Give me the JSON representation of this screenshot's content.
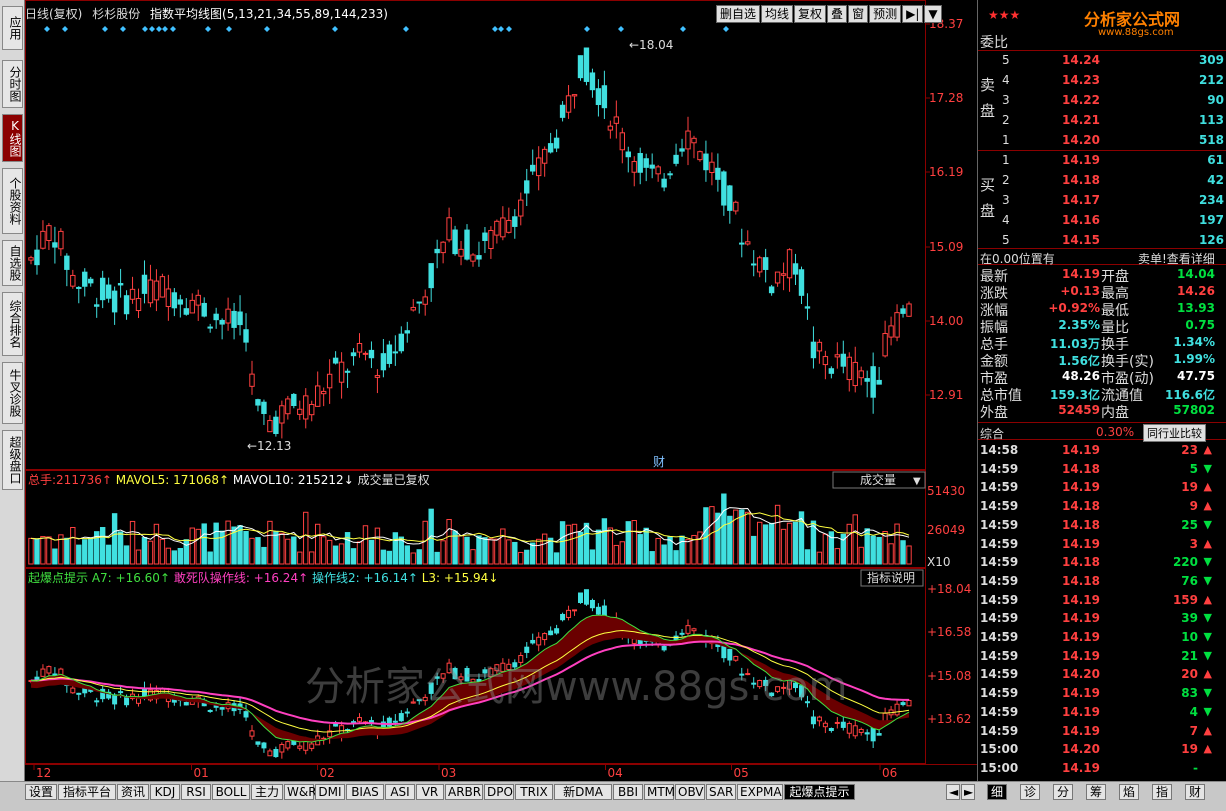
{
  "colors": {
    "up": "#ff4040",
    "down": "#40e0e0",
    "bg": "#000000",
    "grid": "#8b0000",
    "ma_pink": "#ff40c0"
  },
  "left_tabs": [
    {
      "label": "应用",
      "active": false
    },
    {
      "label": "分时图",
      "active": false
    },
    {
      "label": "K线图",
      "active": true
    },
    {
      "label": "个股资料",
      "active": false
    },
    {
      "label": "自选股",
      "active": false
    },
    {
      "label": "综合排名",
      "active": false
    },
    {
      "label": "牛叉诊股",
      "active": false
    },
    {
      "label": "超级盘口",
      "active": false
    }
  ],
  "main_title": {
    "period": "日线(复权)",
    "stock": "杉杉股份",
    "indicator": "指数平均线图(5,13,21,34,55,89,144,233)"
  },
  "toolbar": [
    "删自选",
    "均线",
    "复权",
    "叠",
    "窗",
    "预测",
    "▶|",
    "▼"
  ],
  "price_axis": [
    "18.37",
    "17.28",
    "16.19",
    "15.09",
    "14.00",
    "12.91"
  ],
  "annotations": {
    "high": "18.04",
    "low": "12.13",
    "fin_marker": "财"
  },
  "vol_title": {
    "total_label": "总手:",
    "total_value": "211736↑",
    "mavol5_label": "MAVOL5:",
    "mavol5_value": "171068↑",
    "mavol10_label": "MAVOL10:",
    "mavol10_value": "215212↓",
    "note": "成交量已复权",
    "dropdown": "成交量"
  },
  "vol_axis": [
    "51430",
    "26049",
    "X10"
  ],
  "ind_title": {
    "name": "起爆点提示",
    "a7_label": "A7:",
    "a7_value": "+16.60↑",
    "gan_label": "敢死队操作线:",
    "gan_value": "+16.24↑",
    "op2_label": "操作线2:",
    "op2_value": "+16.14↑",
    "l3_label": "L3:",
    "l3_value": "+15.94↓",
    "btn": "指标说明"
  },
  "ind_axis": [
    "+18.04",
    "+16.58",
    "+15.08",
    "+13.62"
  ],
  "watermark": "分析家公式网www.88gs.com",
  "x_labels": [
    {
      "text": "12",
      "pos": 0.01
    },
    {
      "text": "01",
      "pos": 0.185
    },
    {
      "text": "02",
      "pos": 0.325
    },
    {
      "text": "03",
      "pos": 0.46
    },
    {
      "text": "04",
      "pos": 0.645
    },
    {
      "text": "05",
      "pos": 0.785
    },
    {
      "text": "06",
      "pos": 0.95
    }
  ],
  "chart_data": {
    "type": "candlestick",
    "x_labels": [
      "12",
      "01",
      "02",
      "03",
      "04",
      "05",
      "06"
    ],
    "price_axis": [
      18.37,
      17.28,
      16.19,
      15.09,
      14.0,
      12.91
    ],
    "high": 18.04,
    "low": 12.13,
    "volume_axis": [
      51430,
      26049
    ],
    "indicator_axis": [
      18.04,
      16.58,
      15.08,
      13.62
    ]
  },
  "right_header": {
    "logo": "分析家公式网",
    "url": "www.88gs.com",
    "weibi_label": "委比"
  },
  "order_book": {
    "sell_label": "卖盘",
    "buy_label": "买盘",
    "sells": [
      {
        "n": "5",
        "price": "14.24",
        "vol": "309"
      },
      {
        "n": "4",
        "price": "14.23",
        "vol": "212"
      },
      {
        "n": "3",
        "price": "14.22",
        "vol": "90"
      },
      {
        "n": "2",
        "price": "14.21",
        "vol": "113"
      },
      {
        "n": "1",
        "price": "14.20",
        "vol": "518"
      }
    ],
    "buys": [
      {
        "n": "1",
        "price": "14.19",
        "vol": "61"
      },
      {
        "n": "2",
        "price": "14.18",
        "vol": "42"
      },
      {
        "n": "3",
        "price": "14.17",
        "vol": "234"
      },
      {
        "n": "4",
        "price": "14.16",
        "vol": "197"
      },
      {
        "n": "5",
        "price": "14.15",
        "vol": "126"
      }
    ]
  },
  "position_bar": {
    "left": "在0.00位置有",
    "right": "卖单!查看详细"
  },
  "quote": [
    {
      "l": "最新",
      "v": "14.19",
      "vc": "red",
      "l2": "开盘",
      "v2": "14.04",
      "v2c": "green"
    },
    {
      "l": "涨跌",
      "v": "+0.13",
      "vc": "red",
      "l2": "最高",
      "v2": "14.26",
      "v2c": "red"
    },
    {
      "l": "涨幅",
      "v": "+0.92%",
      "vc": "red",
      "l2": "最低",
      "v2": "13.93",
      "v2c": "green"
    },
    {
      "l": "振幅",
      "v": "2.35%",
      "vc": "cyan",
      "l2": "量比",
      "v2": "0.75",
      "v2c": "green"
    },
    {
      "l": "总手",
      "v": "11.03万",
      "vc": "cyan",
      "l2": "换手",
      "v2": "1.34%",
      "v2c": "cyan"
    },
    {
      "l": "金额",
      "v": "1.56亿",
      "vc": "cyan",
      "l2": "换手(实)",
      "v2": "1.99%",
      "v2c": "cyan"
    },
    {
      "l": "市盈",
      "v": "48.26",
      "vc": "white",
      "l2": "市盈(动)",
      "v2": "47.75",
      "v2c": "white"
    },
    {
      "l": "总市值",
      "v": "159.3亿",
      "vc": "cyan",
      "l2": "流通值",
      "v2": "116.6亿",
      "v2c": "cyan"
    },
    {
      "l": "外盘",
      "v": "52459",
      "vc": "red",
      "l2": "内盘",
      "v2": "57802",
      "v2c": "green"
    }
  ],
  "zonghe": {
    "label": "综合",
    "value": "0.30%",
    "btn": "同行业比较"
  },
  "trades": [
    {
      "t": "14:58",
      "p": "14.19",
      "pc": "red",
      "v": "23",
      "d": "up"
    },
    {
      "t": "14:59",
      "p": "14.18",
      "pc": "red",
      "v": "5",
      "d": "down"
    },
    {
      "t": "14:59",
      "p": "14.19",
      "pc": "red",
      "v": "19",
      "d": "up"
    },
    {
      "t": "14:59",
      "p": "14.18",
      "pc": "red",
      "v": "9",
      "d": "up"
    },
    {
      "t": "14:59",
      "p": "14.18",
      "pc": "red",
      "v": "25",
      "d": "down"
    },
    {
      "t": "14:59",
      "p": "14.19",
      "pc": "red",
      "v": "3",
      "d": "up"
    },
    {
      "t": "14:59",
      "p": "14.18",
      "pc": "red",
      "v": "220",
      "d": "down"
    },
    {
      "t": "14:59",
      "p": "14.18",
      "pc": "red",
      "v": "76",
      "d": "down"
    },
    {
      "t": "14:59",
      "p": "14.19",
      "pc": "red",
      "v": "159",
      "d": "up"
    },
    {
      "t": "14:59",
      "p": "14.19",
      "pc": "red",
      "v": "39",
      "d": "down"
    },
    {
      "t": "14:59",
      "p": "14.19",
      "pc": "red",
      "v": "10",
      "d": "down"
    },
    {
      "t": "14:59",
      "p": "14.19",
      "pc": "red",
      "v": "21",
      "d": "down"
    },
    {
      "t": "14:59",
      "p": "14.20",
      "pc": "red",
      "v": "20",
      "d": "up"
    },
    {
      "t": "14:59",
      "p": "14.19",
      "pc": "red",
      "v": "83",
      "d": "down"
    },
    {
      "t": "14:59",
      "p": "14.19",
      "pc": "red",
      "v": "4",
      "d": "down"
    },
    {
      "t": "14:59",
      "p": "14.19",
      "pc": "red",
      "v": "7",
      "d": "up"
    },
    {
      "t": "15:00",
      "p": "14.20",
      "pc": "red",
      "v": "19",
      "d": "up"
    },
    {
      "t": "15:00",
      "p": "14.19",
      "pc": "red",
      "v": "-",
      "d": "none"
    }
  ],
  "bottom_tabs": [
    "设置",
    "指标平台",
    "资讯",
    "KDJ",
    "RSI",
    "BOLL",
    "主力",
    "W&R",
    "DMI",
    "BIAS",
    "ASI",
    "VR",
    "ARBR",
    "DPO",
    "TRIX",
    "新DMA",
    "BBI",
    "MTM",
    "OBV",
    "SAR",
    "EXPMA",
    "起爆点提示"
  ],
  "right_tabs": [
    "细",
    "诊",
    "分",
    "筹",
    "焰",
    "指",
    "财"
  ]
}
